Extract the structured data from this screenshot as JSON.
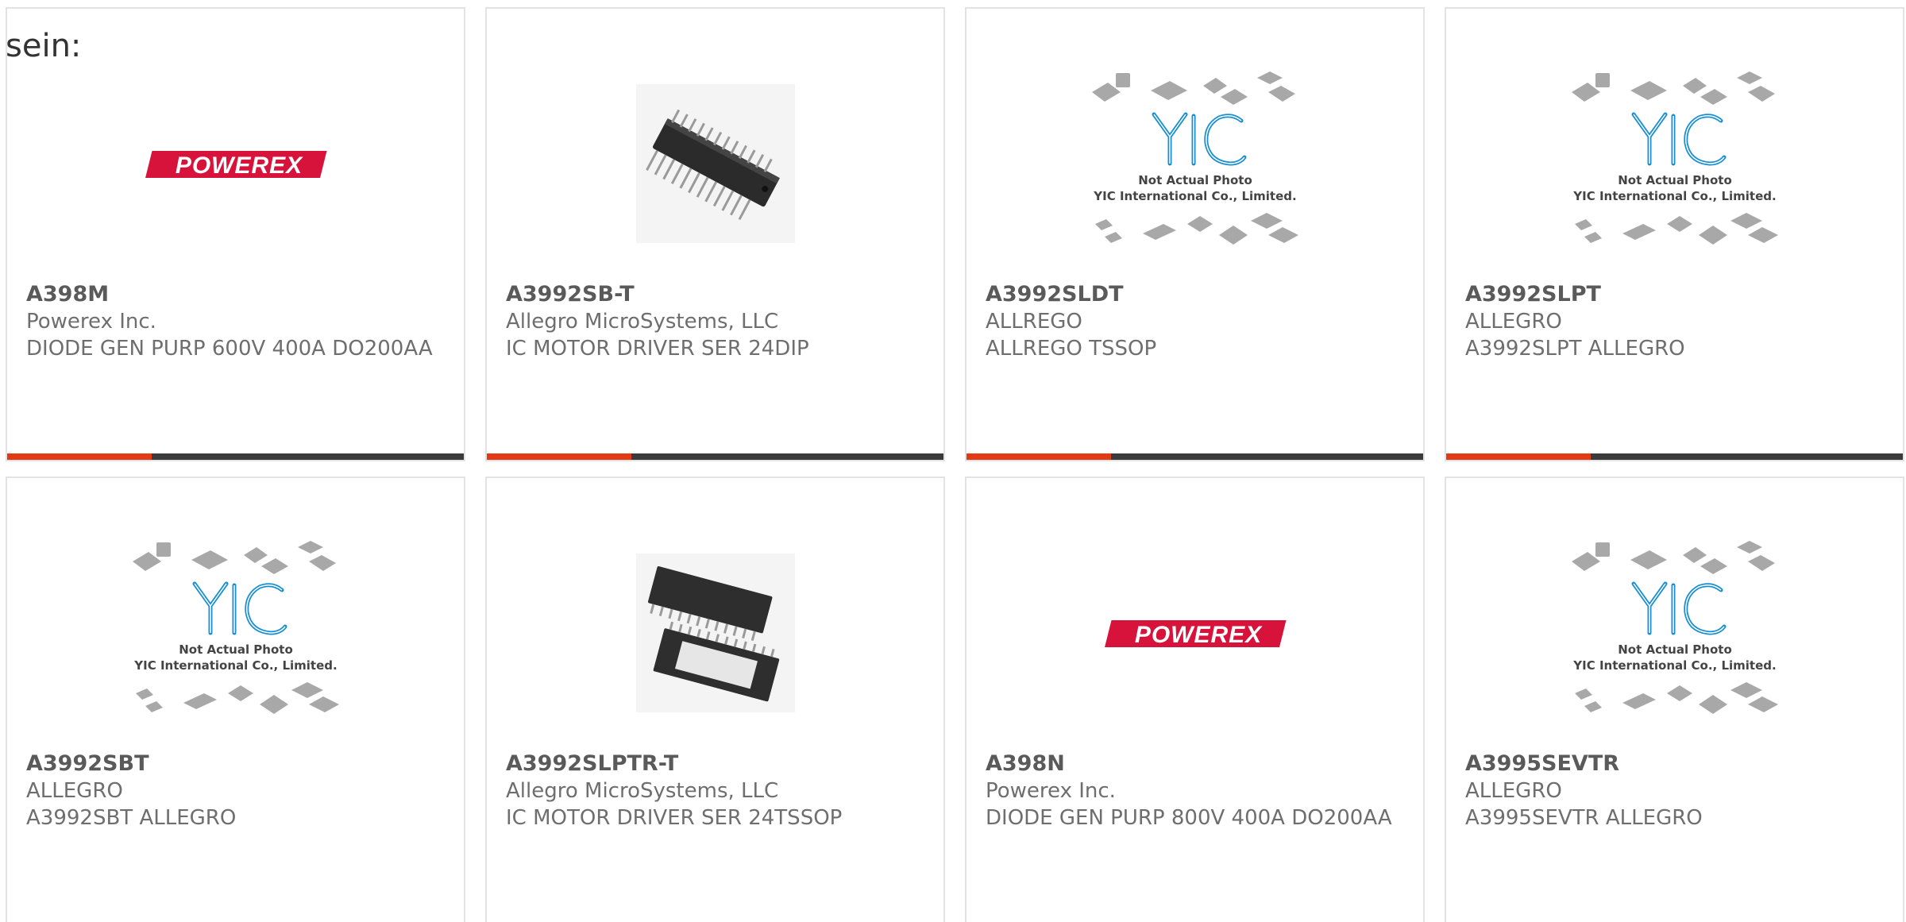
{
  "intro_text": "sein:",
  "colors": {
    "accent": "#e33a14",
    "bar": "#3b3b3b",
    "powerex_red": "#d7133b",
    "yic_blue": "#1a8fd0"
  },
  "products": [
    {
      "part": "A398M",
      "maker": "Powerex Inc.",
      "description": "DIODE GEN PURP 600V 400A DO200AA",
      "image": "powerex-logo",
      "logo_text": "POWEREX"
    },
    {
      "part": "A3992SB-T",
      "maker": "Allegro MicroSystems, LLC",
      "description": "IC MOTOR DRIVER SER 24DIP",
      "image": "dip-chip-photo"
    },
    {
      "part": "A3992SLDT",
      "maker": "ALLREGO",
      "description": "ALLREGO TSSOP",
      "image": "yic-placeholder",
      "photo_note": "Not Actual Photo",
      "photo_company": "YIC International Co., Limited."
    },
    {
      "part": "A3992SLPT",
      "maker": "ALLEGRO",
      "description": "A3992SLPT ALLEGRO",
      "image": "yic-placeholder",
      "photo_note": "Not Actual Photo",
      "photo_company": "YIC International Co., Limited."
    },
    {
      "part": "A3992SBT",
      "maker": "ALLEGRO",
      "description": "A3992SBT ALLEGRO",
      "image": "yic-placeholder",
      "photo_note": "Not Actual Photo",
      "photo_company": "YIC International Co., Limited."
    },
    {
      "part": "A3992SLPTR-T",
      "maker": "Allegro MicroSystems, LLC",
      "description": "IC MOTOR DRIVER SER 24TSSOP",
      "image": "tssop-chip-photo"
    },
    {
      "part": "A398N",
      "maker": "Powerex Inc.",
      "description": "DIODE GEN PURP 800V 400A DO200AA",
      "image": "powerex-logo",
      "logo_text": "POWEREX"
    },
    {
      "part": "A3995SEVTR",
      "maker": "ALLEGRO",
      "description": "A3995SEVTR ALLEGRO",
      "image": "yic-placeholder",
      "photo_note": "Not Actual Photo",
      "photo_company": "YIC International Co., Limited."
    }
  ]
}
